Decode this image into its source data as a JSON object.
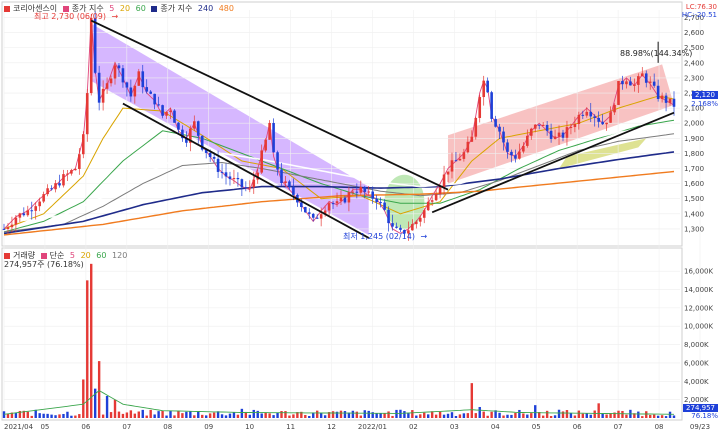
{
  "price_legend": {
    "series_name": "코리아센스이",
    "ma_label": "종가 지수",
    "ma_periods": [
      "5",
      "20",
      "60"
    ],
    "long_ma_label": "종가 지수",
    "long_ma_periods": [
      "240",
      "480"
    ]
  },
  "volume_legend": {
    "series_name": "거래량",
    "ma_label": "단순",
    "ma_periods": [
      "5",
      "20",
      "60",
      "120"
    ],
    "current": "274,957주 (76.18%)"
  },
  "right_labels": {
    "lc": "LC:76.30",
    "hc": "HC:-20.51",
    "price_box": "2,120",
    "price_box2": "2,168%",
    "vol_box": "274,957",
    "vol_box2": "76.18%"
  },
  "annotations": {
    "high": "최고 2,730 (06/09)",
    "low": "최저 1,245 (02/14)",
    "channel": "88.98%(144.34%)"
  },
  "colors": {
    "ma5": "#e0457b",
    "ma20": "#d9a400",
    "ma60": "#3aa64c",
    "ma120": "#7b7b7b",
    "ma240": "#1f2b8a",
    "ma480": "#f07b1f",
    "up": "#e53935",
    "down": "#1e40d8",
    "purple_zone": "#b57bff",
    "red_zone": "#f39a9a",
    "green_zone": "#8bd67a"
  },
  "chart_data": {
    "type": "candlestick",
    "price_axis": {
      "ylim": [
        1200,
        2750
      ],
      "ticks": [
        "2,700",
        "2,600",
        "2,500",
        "2,400",
        "2,300",
        "2,200",
        "2,100",
        "2,000",
        "1,900",
        "1,800",
        "1,700",
        "1,600",
        "1,500",
        "1,400",
        "1,300"
      ]
    },
    "volume_axis": {
      "ylim": [
        0,
        17000
      ],
      "ticks": [
        "16,000K",
        "14,000K",
        "12,000K",
        "10,000K",
        "8,000K",
        "6,000K",
        "4,000K",
        "2,000K"
      ]
    },
    "x_labels": [
      "2021/04",
      "05",
      "06",
      "07",
      "08",
      "09",
      "10",
      "11",
      "12",
      "2022/01",
      "02",
      "03",
      "04",
      "05",
      "06",
      "07",
      "08",
      "09/23"
    ],
    "price_path": [
      [
        0,
        1300
      ],
      [
        3,
        1380
      ],
      [
        6,
        1420
      ],
      [
        9,
        1500
      ],
      [
        12,
        1560
      ],
      [
        15,
        1640
      ],
      [
        18,
        1700
      ],
      [
        20,
        1900
      ],
      [
        21,
        2200
      ],
      [
        22,
        2700
      ],
      [
        23,
        2350
      ],
      [
        24,
        2150
      ],
      [
        26,
        2250
      ],
      [
        28,
        2400
      ],
      [
        30,
        2300
      ],
      [
        32,
        2180
      ],
      [
        34,
        2320
      ],
      [
        36,
        2200
      ],
      [
        38,
        2150
      ],
      [
        40,
        2050
      ],
      [
        42,
        2100
      ],
      [
        44,
        1950
      ],
      [
        46,
        1900
      ],
      [
        48,
        2000
      ],
      [
        50,
        1850
      ],
      [
        52,
        1780
      ],
      [
        54,
        1700
      ],
      [
        56,
        1650
      ],
      [
        58,
        1620
      ],
      [
        60,
        1580
      ],
      [
        62,
        1560
      ],
      [
        64,
        1700
      ],
      [
        66,
        1880
      ],
      [
        67,
        2000
      ],
      [
        68,
        1780
      ],
      [
        70,
        1620
      ],
      [
        72,
        1560
      ],
      [
        74,
        1500
      ],
      [
        76,
        1420
      ],
      [
        78,
        1350
      ],
      [
        80,
        1420
      ],
      [
        82,
        1480
      ],
      [
        84,
        1460
      ],
      [
        86,
        1500
      ],
      [
        88,
        1560
      ],
      [
        90,
        1560
      ],
      [
        92,
        1520
      ],
      [
        94,
        1500
      ],
      [
        96,
        1420
      ],
      [
        98,
        1300
      ],
      [
        100,
        1270
      ],
      [
        102,
        1300
      ],
      [
        104,
        1350
      ],
      [
        106,
        1420
      ],
      [
        108,
        1520
      ],
      [
        110,
        1600
      ],
      [
        112,
        1700
      ],
      [
        114,
        1750
      ],
      [
        116,
        1800
      ],
      [
        118,
        1900
      ],
      [
        120,
        2200
      ],
      [
        121,
        2280
      ],
      [
        122,
        2230
      ],
      [
        123,
        2050
      ],
      [
        125,
        1950
      ],
      [
        127,
        1800
      ],
      [
        129,
        1780
      ],
      [
        131,
        1850
      ],
      [
        133,
        1950
      ],
      [
        135,
        2000
      ],
      [
        137,
        1950
      ],
      [
        139,
        1900
      ],
      [
        141,
        1920
      ],
      [
        143,
        1980
      ],
      [
        145,
        2050
      ],
      [
        147,
        2100
      ],
      [
        149,
        2050
      ],
      [
        151,
        2000
      ],
      [
        153,
        2050
      ],
      [
        155,
        2250
      ],
      [
        157,
        2300
      ],
      [
        159,
        2250
      ],
      [
        161,
        2320
      ],
      [
        163,
        2260
      ],
      [
        165,
        2180
      ],
      [
        167,
        2150
      ],
      [
        169,
        2120
      ]
    ],
    "ma_lines": {
      "ma20": [
        [
          0,
          1300
        ],
        [
          10,
          1400
        ],
        [
          20,
          1650
        ],
        [
          25,
          1900
        ],
        [
          30,
          2100
        ],
        [
          40,
          2080
        ],
        [
          50,
          1920
        ],
        [
          60,
          1750
        ],
        [
          70,
          1700
        ],
        [
          80,
          1500
        ],
        [
          90,
          1520
        ],
        [
          100,
          1400
        ],
        [
          110,
          1480
        ],
        [
          118,
          1750
        ],
        [
          125,
          1900
        ],
        [
          135,
          1950
        ],
        [
          145,
          2000
        ],
        [
          155,
          2100
        ],
        [
          165,
          2180
        ],
        [
          169,
          2160
        ]
      ],
      "ma60": [
        [
          0,
          1280
        ],
        [
          10,
          1350
        ],
        [
          20,
          1480
        ],
        [
          30,
          1750
        ],
        [
          40,
          1950
        ],
        [
          50,
          1900
        ],
        [
          60,
          1800
        ],
        [
          70,
          1700
        ],
        [
          80,
          1600
        ],
        [
          90,
          1520
        ],
        [
          100,
          1470
        ],
        [
          110,
          1470
        ],
        [
          120,
          1560
        ],
        [
          130,
          1700
        ],
        [
          140,
          1820
        ],
        [
          150,
          1900
        ],
        [
          160,
          1980
        ],
        [
          169,
          2020
        ]
      ],
      "ma120": [
        [
          0,
          1280
        ],
        [
          15,
          1330
        ],
        [
          25,
          1450
        ],
        [
          35,
          1600
        ],
        [
          45,
          1720
        ],
        [
          55,
          1740
        ],
        [
          65,
          1700
        ],
        [
          75,
          1650
        ],
        [
          85,
          1600
        ],
        [
          95,
          1550
        ],
        [
          105,
          1520
        ],
        [
          115,
          1540
        ],
        [
          125,
          1620
        ],
        [
          135,
          1720
        ],
        [
          145,
          1820
        ],
        [
          155,
          1880
        ],
        [
          169,
          1930
        ]
      ],
      "ma240": [
        [
          0,
          1270
        ],
        [
          20,
          1350
        ],
        [
          35,
          1460
        ],
        [
          50,
          1540
        ],
        [
          65,
          1580
        ],
        [
          80,
          1580
        ],
        [
          95,
          1570
        ],
        [
          110,
          1580
        ],
        [
          125,
          1630
        ],
        [
          140,
          1700
        ],
        [
          155,
          1760
        ],
        [
          169,
          1810
        ]
      ],
      "ma480": [
        [
          0,
          1260
        ],
        [
          25,
          1330
        ],
        [
          45,
          1420
        ],
        [
          65,
          1480
        ],
        [
          85,
          1520
        ],
        [
          105,
          1530
        ],
        [
          120,
          1550
        ],
        [
          135,
          1590
        ],
        [
          150,
          1630
        ],
        [
          169,
          1680
        ]
      ]
    },
    "volume_spikes": [
      [
        20,
        4200
      ],
      [
        21,
        15000
      ],
      [
        22,
        16800
      ],
      [
        23,
        3200
      ],
      [
        24,
        6200
      ],
      [
        26,
        2400
      ],
      [
        28,
        2000
      ],
      [
        40,
        800
      ],
      [
        60,
        1000
      ],
      [
        80,
        600
      ],
      [
        100,
        900
      ],
      [
        118,
        3800
      ],
      [
        120,
        1200
      ],
      [
        134,
        1400
      ],
      [
        140,
        900
      ],
      [
        150,
        1600
      ],
      [
        160,
        700
      ],
      [
        169,
        275
      ]
    ]
  }
}
